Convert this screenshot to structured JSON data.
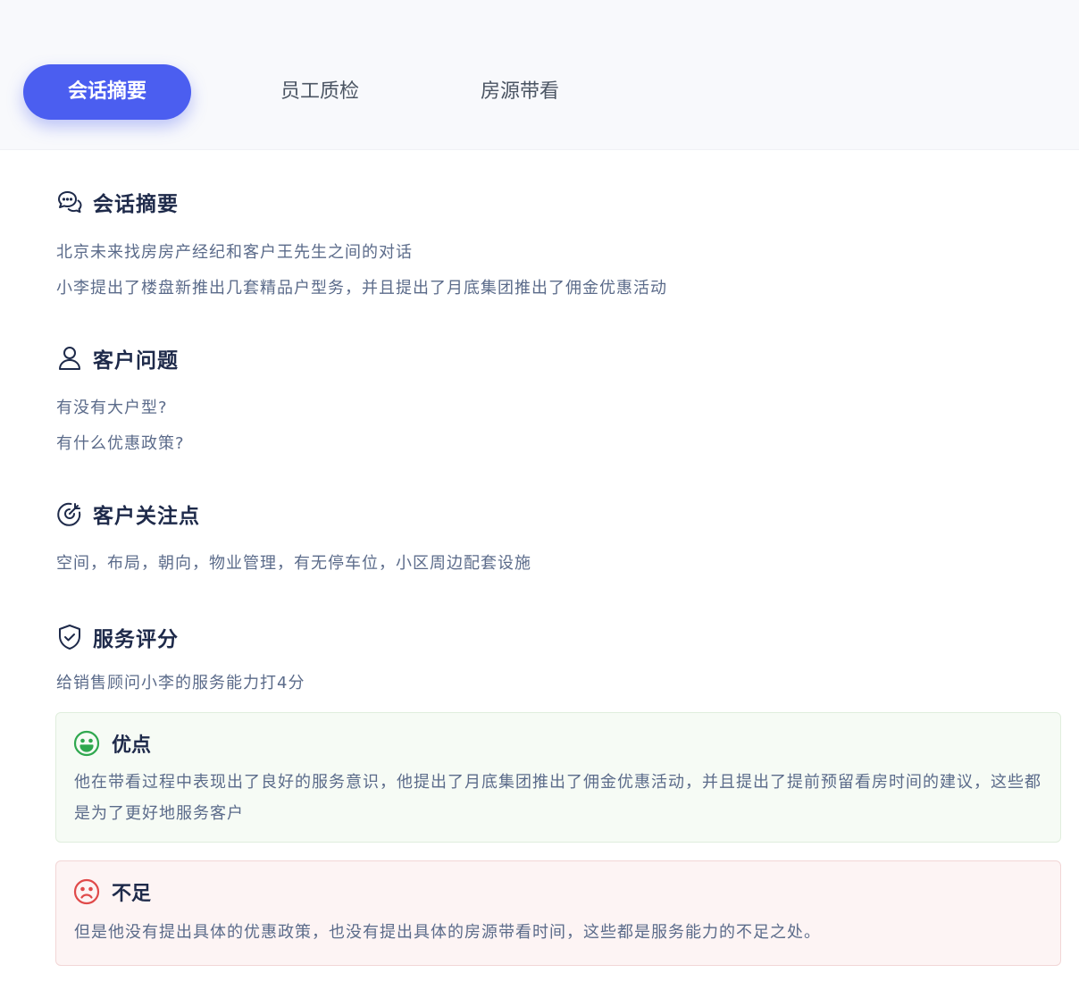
{
  "tabs": [
    {
      "label": "会话摘要",
      "active": true
    },
    {
      "label": "员工质检",
      "active": false
    },
    {
      "label": "房源带看",
      "active": false
    }
  ],
  "summary": {
    "title": "会话摘要",
    "icon": "chat-bubble-icon",
    "lines": [
      "北京未来找房房产经纪和客户王先生之间的对话",
      "小李提出了楼盘新推出几套精品户型务，并且提出了月底集团推出了佣金优惠活动"
    ]
  },
  "questions": {
    "title": "客户问题",
    "icon": "user-icon",
    "lines": [
      "有没有大户型?",
      "有什么优惠政策?"
    ]
  },
  "concerns": {
    "title": "客户关注点",
    "icon": "target-icon",
    "lines": [
      "空间，布局，朝向，物业管理，有无停车位，小区周边配套设施"
    ]
  },
  "rating": {
    "title": "服务评分",
    "icon": "shield-check-icon",
    "line": "给销售顾问小李的服务能力打4分",
    "strengths": {
      "title": "优点",
      "icon": "smile-face-icon",
      "text": "他在带看过程中表现出了良好的服务意识，他提出了月底集团推出了佣金优惠活动，并且提出了提前预留看房时间的建议，这些都是为了更好地服务客户"
    },
    "weaknesses": {
      "title": "不足",
      "icon": "frown-face-icon",
      "text": "但是他没有提出具体的优惠政策，也没有提出具体的房源带看时间，这些都是服务能力的不足之处。"
    }
  },
  "colors": {
    "accent": "#4b5ef0",
    "heading": "#1e2a4a",
    "body_text": "#5b6b8a",
    "good": "#2fa84f",
    "bad": "#e04a4a"
  }
}
